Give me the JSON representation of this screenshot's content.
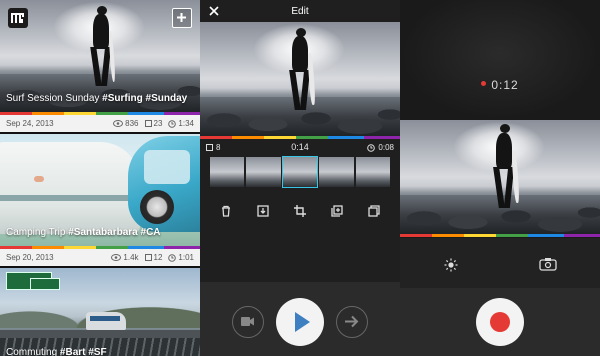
{
  "feed": {
    "cards": [
      {
        "caption_plain": "Surf Session Sunday ",
        "caption_tags": "#Surfing #Sunday",
        "date": "Sep 24, 2013",
        "views": "836",
        "clips": "23",
        "duration": "1:34"
      },
      {
        "caption_plain": "Camping Trip ",
        "caption_tags": "#Santabarbara #CA",
        "date": "Sep 20, 2013",
        "views": "1.4k",
        "clips": "12",
        "duration": "1:01"
      },
      {
        "caption_plain": "Commuting ",
        "caption_tags": "#Bart #SF"
      }
    ]
  },
  "edit": {
    "title": "Edit",
    "clip_count": "8",
    "position_time": "0:14",
    "clip_duration": "0:08"
  },
  "record": {
    "elapsed": "0:12"
  },
  "colors": {
    "accent": "#39c6e6",
    "record_red": "#e53935",
    "play_blue": "#3d7fc1"
  }
}
